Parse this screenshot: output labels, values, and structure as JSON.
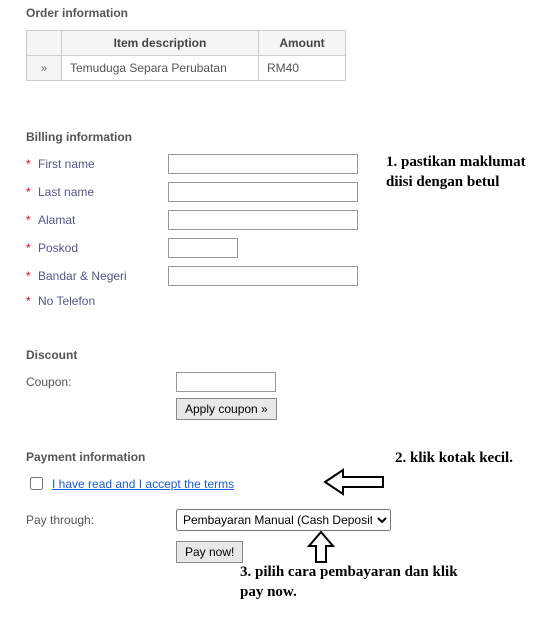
{
  "order": {
    "section_title": "Order information",
    "col_item": "Item description",
    "col_amount": "Amount",
    "row_marker": "»",
    "item": "Temuduga Separa Perubatan",
    "amount": "RM40"
  },
  "billing": {
    "section_title": "Billing information",
    "fields": {
      "first_name": "First name",
      "last_name": "Last name",
      "alamat": "Alamat",
      "poskod": "Poskod",
      "bandar": "Bandar & Negeri",
      "phone": "No Telefon"
    }
  },
  "discount": {
    "section_title": "Discount",
    "coupon_label": "Coupon:",
    "apply_label": "Apply coupon »"
  },
  "payment": {
    "section_title": "Payment information",
    "terms_text": "I have read and I accept the terms",
    "pay_through_label": "Pay through:",
    "method_selected": "Pembayaran Manual (Cash Deposit)",
    "pay_now_label": "Pay now!"
  },
  "annotations": {
    "a1": "1.  pastikan maklumat diisi dengan betul",
    "a2": "2. klik kotak kecil.",
    "a3": "3. pilih cara pembayaran dan klik pay now."
  }
}
